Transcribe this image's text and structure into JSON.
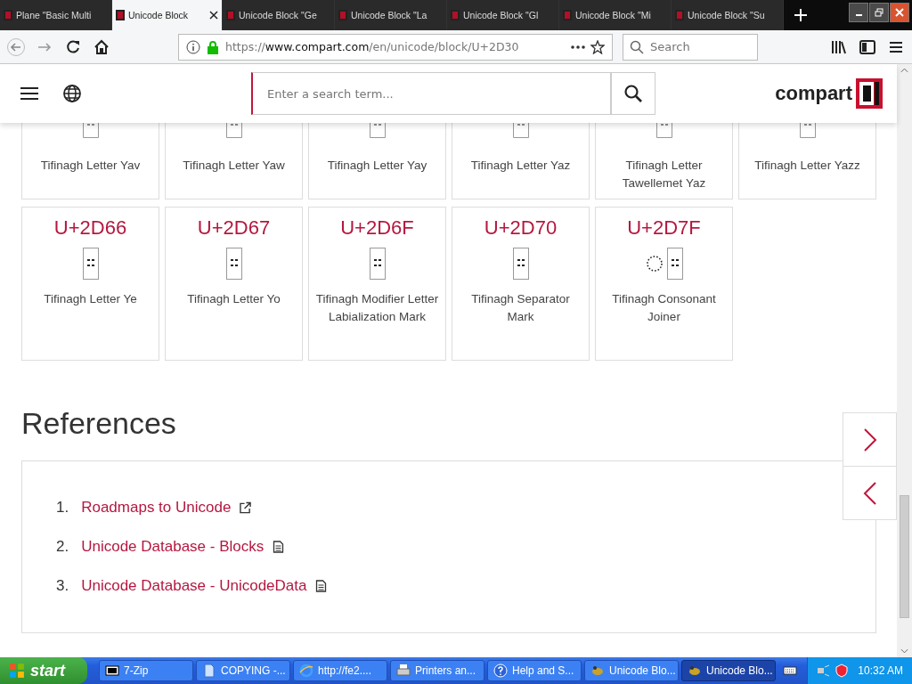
{
  "browser": {
    "tabs": [
      {
        "title": "Plane \"Basic Multi",
        "selected": false
      },
      {
        "title": "Unicode Block",
        "selected": true
      },
      {
        "title": "Unicode Block \"Ge",
        "selected": false
      },
      {
        "title": "Unicode Block \"La",
        "selected": false
      },
      {
        "title": "Unicode Block \"Gl",
        "selected": false
      },
      {
        "title": "Unicode Block \"Mi",
        "selected": false
      },
      {
        "title": "Unicode Block \"Su",
        "selected": false
      }
    ],
    "url": {
      "scheme": "https://",
      "domain": "www.compart.com",
      "path": "/en/unicode/block/U+2D30"
    },
    "search": {
      "placeholder": "Search"
    }
  },
  "site": {
    "search": {
      "placeholder": "Enter a search term..."
    },
    "logo": "compart"
  },
  "cards": [
    {
      "kind": "clipped",
      "name": "Tifinagh Letter Yav"
    },
    {
      "kind": "clipped",
      "name": "Tifinagh Letter Yaw"
    },
    {
      "kind": "clipped",
      "name": "Tifinagh Letter Yay"
    },
    {
      "kind": "clipped",
      "name": "Tifinagh Letter Yaz"
    },
    {
      "kind": "clipped",
      "name": "Tifinagh Letter Tawellemet Yaz"
    },
    {
      "kind": "clipped",
      "name": "Tifinagh Letter Yazz"
    },
    {
      "kind": "full",
      "code": "U+2D66",
      "combining": false,
      "name": "Tifinagh Letter Ye"
    },
    {
      "kind": "full",
      "code": "U+2D67",
      "combining": false,
      "name": "Tifinagh Letter Yo"
    },
    {
      "kind": "full",
      "code": "U+2D6F",
      "combining": false,
      "name": "Tifinagh Modifier Letter Labialization Mark"
    },
    {
      "kind": "full",
      "code": "U+2D70",
      "combining": false,
      "name": "Tifinagh Separator Mark"
    },
    {
      "kind": "full",
      "code": "U+2D7F",
      "combining": true,
      "name": "Tifinagh Consonant Joiner"
    }
  ],
  "references": {
    "heading": "References",
    "items": [
      {
        "number": "1.",
        "label": "Roadmaps to Unicode",
        "kind": "external"
      },
      {
        "number": "2.",
        "label": "Unicode Database - Blocks",
        "kind": "document"
      },
      {
        "number": "3.",
        "label": "Unicode Database - UnicodeData",
        "kind": "document"
      }
    ]
  },
  "taskbar": {
    "start": "start",
    "items": [
      {
        "label": "7-Zip",
        "kind": "archive",
        "selected": false
      },
      {
        "label": "COPYING -...",
        "kind": "document",
        "selected": false
      },
      {
        "label": "http://fe2....",
        "kind": "browser",
        "selected": false
      },
      {
        "label": "Printers an...",
        "kind": "printer",
        "selected": false
      },
      {
        "label": "Help and S...",
        "kind": "help",
        "selected": false
      },
      {
        "label": "Unicode Blo...",
        "kind": "app",
        "selected": false
      },
      {
        "label": "Unicode Blo...",
        "kind": "app",
        "selected": true
      }
    ],
    "clock": "10:32 AM"
  }
}
